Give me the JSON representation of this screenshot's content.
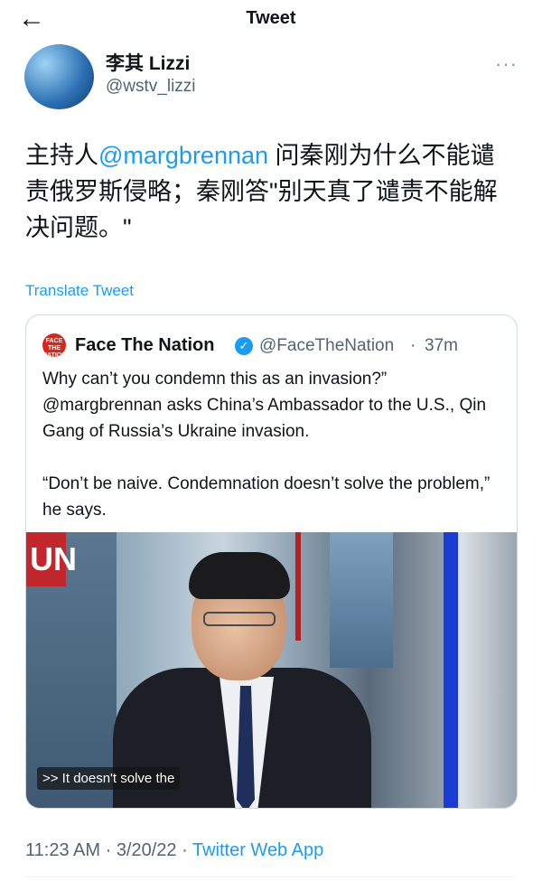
{
  "header": {
    "title": "Tweet",
    "back_icon": "←"
  },
  "author": {
    "display_name": "李其 Lizzi",
    "handle": "@wstv_lizzi",
    "more_icon": "···"
  },
  "tweet": {
    "text_prefix": "主持人",
    "mention": "@margbrennan",
    "text_suffix": " 问秦刚为什么不能谴责俄罗斯侵略；秦刚答\"别天真了谴责不能解决问题。\""
  },
  "translate_label": "Translate Tweet",
  "quote": {
    "logo_text": "FACE THE NATION",
    "name": "Face The Nation",
    "verified_icon": "✓",
    "handle": "@FaceTheNation",
    "separator": "·",
    "time": "37m",
    "text": "Why can’t you condemn this as an invasion?” @margbrennan asks China’s Ambassador to the U.S., Qin Gang of Russia’s Ukraine invasion.\n\n“Don’t be naive. Condemnation doesn’t solve the problem,” he says.",
    "video": {
      "corner_logo": "UN",
      "caption": ">> It doesn't solve the"
    }
  },
  "footer": {
    "time": "11:23 AM",
    "sep1": " · ",
    "date": "3/20/22",
    "sep2": " · ",
    "source": "Twitter Web App"
  }
}
